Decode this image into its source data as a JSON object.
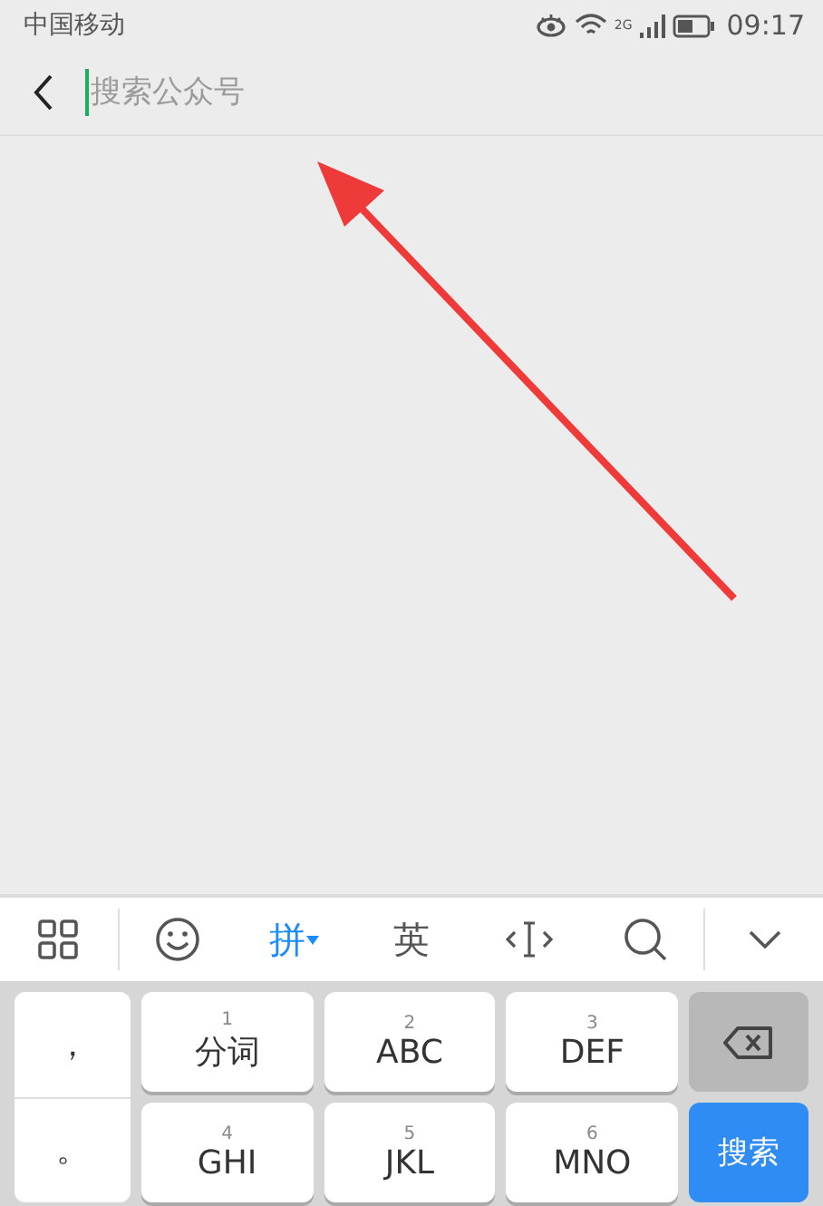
{
  "status_bar": {
    "carrier": "中国移动",
    "network": "2G",
    "time": "09:17"
  },
  "search": {
    "placeholder": "搜索公众号"
  },
  "keyboard": {
    "toolbar": [
      {
        "kind": "grid"
      },
      {
        "kind": "emoji"
      },
      {
        "kind": "text",
        "label": "拼",
        "selected": true
      },
      {
        "kind": "text",
        "label": "英",
        "selected": false
      },
      {
        "kind": "cursor"
      },
      {
        "kind": "search"
      },
      {
        "kind": "collapse"
      }
    ],
    "punctuation": [
      "，",
      "。"
    ],
    "keys": [
      {
        "digit": "1",
        "label": "分词"
      },
      {
        "digit": "2",
        "label": "ABC"
      },
      {
        "digit": "3",
        "label": "DEF"
      },
      {
        "digit": "4",
        "label": "GHI"
      },
      {
        "digit": "5",
        "label": "JKL"
      },
      {
        "digit": "6",
        "label": "MNO"
      }
    ],
    "search_key": "搜索"
  }
}
